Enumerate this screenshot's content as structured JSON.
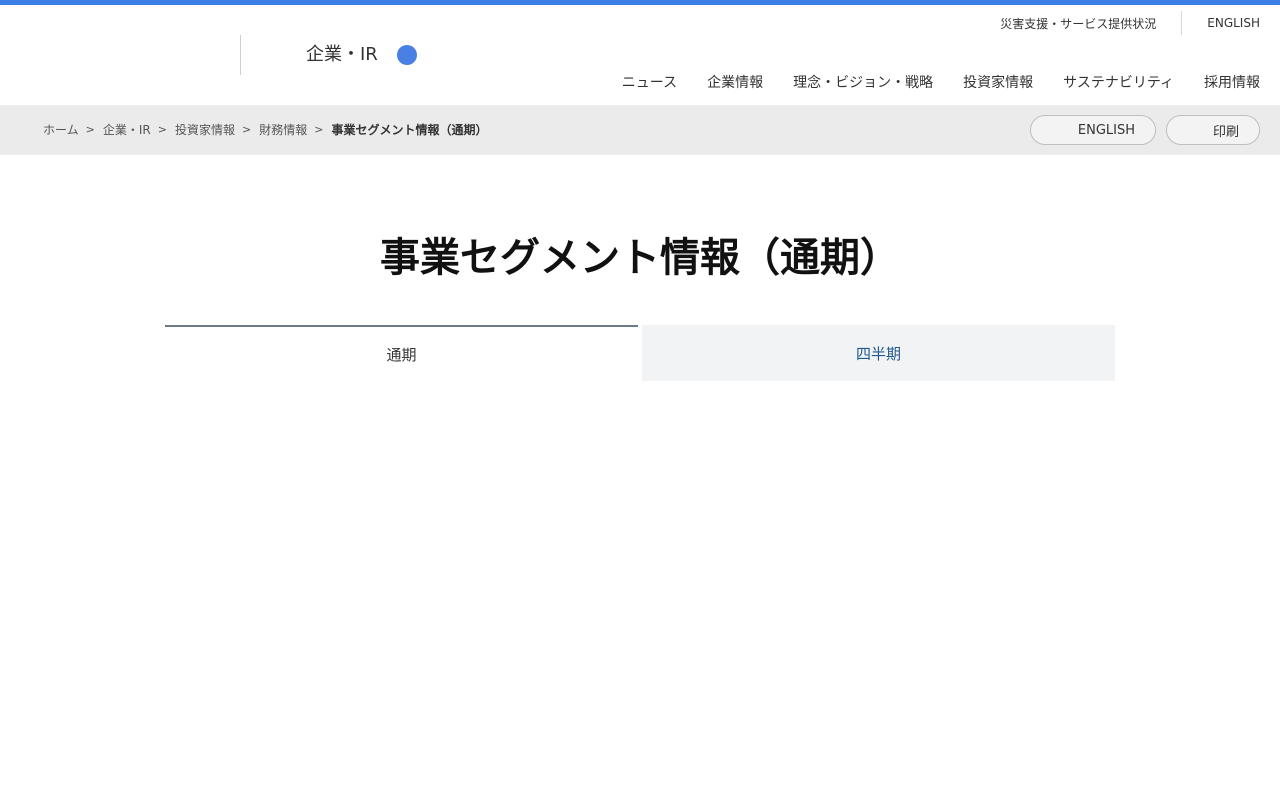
{
  "utility_nav": {
    "disaster_support": "災害支援・サービス提供状況",
    "english": "ENGLISH"
  },
  "header": {
    "section_title": "企業・IR",
    "accent_color": "#3a7ee6",
    "dot_color": "#4a7fe4"
  },
  "main_nav": {
    "items": [
      {
        "label": "ニュース"
      },
      {
        "label": "企業情報"
      },
      {
        "label": "理念・ビジョン・戦略"
      },
      {
        "label": "投資家情報"
      },
      {
        "label": "サステナビリティ"
      },
      {
        "label": "採用情報"
      }
    ]
  },
  "breadcrumb": {
    "items": [
      {
        "label": "ホーム"
      },
      {
        "label": "企業・IR"
      },
      {
        "label": "投資家情報"
      },
      {
        "label": "財務情報"
      }
    ],
    "separator": ">",
    "current": "事業セグメント情報（通期）"
  },
  "actions": {
    "english_label": "ENGLISH",
    "print_label": "印刷"
  },
  "page": {
    "title": "事業セグメント情報（通期）"
  },
  "tabs": {
    "annual_label": "通期",
    "quarterly_label": "四半期",
    "active": "通期"
  }
}
